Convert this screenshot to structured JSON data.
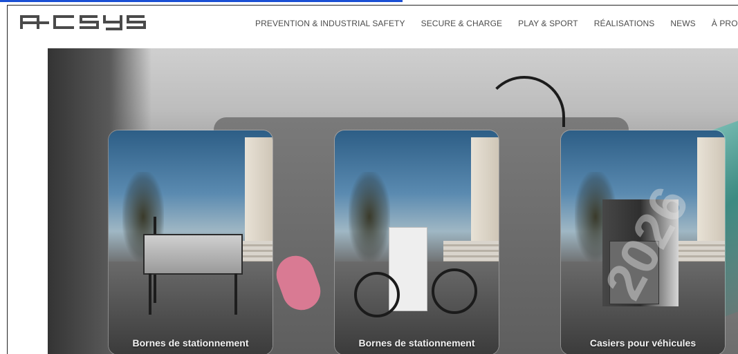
{
  "brand": {
    "logo_text": "A-CSYS"
  },
  "nav": {
    "items": [
      {
        "label": "PREVENTION & INDUSTRIAL SAFETY"
      },
      {
        "label": "SECURE & CHARGE"
      },
      {
        "label": "PLAY & SPORT"
      },
      {
        "label": "RÉALISATIONS"
      },
      {
        "label": "NEWS"
      },
      {
        "label": "À PROPOS"
      }
    ]
  },
  "cards": [
    {
      "title": "Bornes de stationnement"
    },
    {
      "title": "Bornes de stationnement"
    },
    {
      "title": "Casiers pour véhicules"
    }
  ],
  "watermark": "2026",
  "colors": {
    "top_accent": "#1a4fd4",
    "nav_text": "#4b4b4b",
    "card_label": "#f2f2f2"
  }
}
